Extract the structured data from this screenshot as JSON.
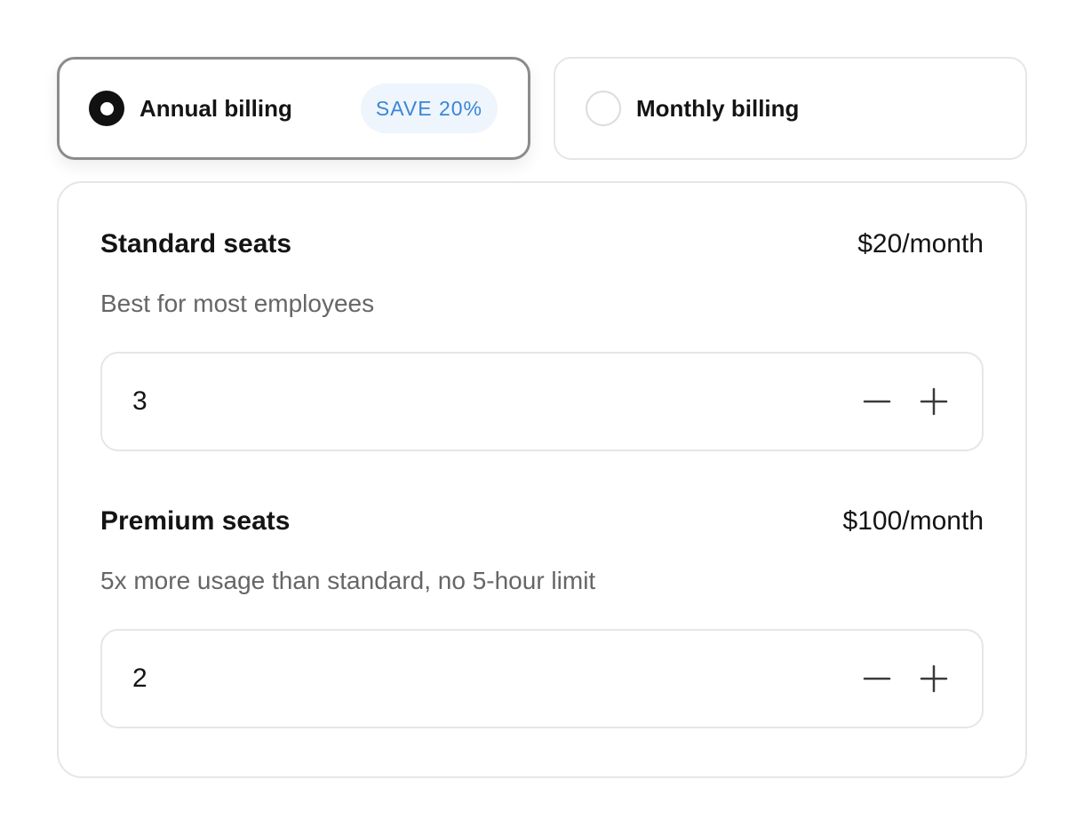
{
  "billing": {
    "annual": {
      "label": "Annual billing",
      "badge": "SAVE 20%",
      "selected": true
    },
    "monthly": {
      "label": "Monthly billing",
      "selected": false
    }
  },
  "seats": {
    "standard": {
      "title": "Standard seats",
      "price": "$20/month",
      "description": "Best for most employees",
      "quantity": "3"
    },
    "premium": {
      "title": "Premium seats",
      "price": "$100/month",
      "description": "5x more usage than standard, no 5-hour limit",
      "quantity": "2"
    }
  },
  "icons": {
    "decrement": "minus-icon",
    "increment": "plus-icon"
  },
  "colors": {
    "accent_badge_text": "#3a86d6",
    "accent_badge_bg": "#eef5fd",
    "selected_border": "#8c8c8c",
    "border": "#e6e6e6"
  }
}
